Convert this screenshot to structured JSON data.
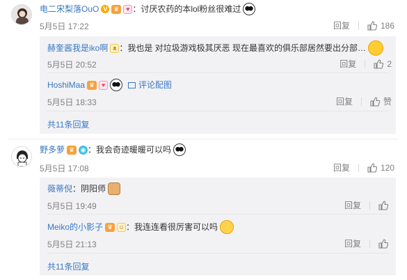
{
  "comments": [
    {
      "user": "电二宋梨落OuO",
      "text": "：讨厌农药的本lol粉丝很难过",
      "time": "5月5日 17:22",
      "reply_label": "回复",
      "likes": "186",
      "replies": [
        {
          "user": "赫奎酱我是iko啊",
          "text": "：我也是 对垃圾游戏极其厌恶 现在最喜欢的俱乐部居然要出分部…",
          "time": "5月5日 20:52",
          "reply_label": "回复",
          "likes": "2"
        },
        {
          "user": "HoshiMaa",
          "text": "评论配图",
          "time": "5月5日 18:33",
          "reply_label": "回复",
          "likes": "赞"
        }
      ],
      "more_label": "共11条回复"
    },
    {
      "user": "野多萝",
      "text": "：我会奇迹暖暖可以吗",
      "time": "5月5日 17:08",
      "reply_label": "回复",
      "likes": "120",
      "replies": [
        {
          "user": "薇蒂倪",
          "text": "：阴阳师",
          "time": "5月5日 19:49",
          "reply_label": "回复",
          "likes": ""
        },
        {
          "user": "Meiko的小影子",
          "text": "：我连连看很厉害可以吗",
          "time": "5月5日 21:13",
          "reply_label": "回复",
          "likes": ""
        }
      ],
      "more_label": "共11条回复"
    }
  ]
}
